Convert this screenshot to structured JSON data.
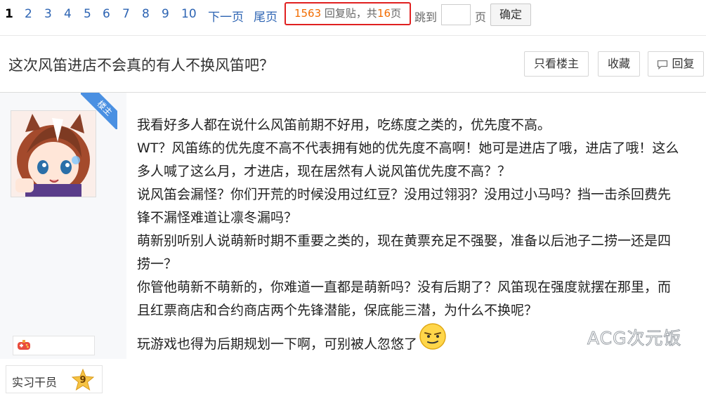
{
  "pager": {
    "pages": [
      "1",
      "2",
      "3",
      "4",
      "5",
      "6",
      "7",
      "8",
      "9",
      "10"
    ],
    "current": "1",
    "next_label": "下一页",
    "last_label": "尾页",
    "reply_count": "1563",
    "reply_text": "回复贴，共",
    "page_total": "16",
    "page_unit": "页",
    "jump_label": "跳到",
    "page_label": "页",
    "confirm_label": "确定"
  },
  "thread": {
    "title": "这次风笛进店不会真的有人不换风笛吧？",
    "btn_only_op": "只看楼主",
    "btn_favorite": "收藏",
    "btn_reply": "回复"
  },
  "author": {
    "owner_tag": "楼主",
    "level_title": "实习干员",
    "level": "9"
  },
  "post": {
    "lines": [
      "我看好多人都在说什么风笛前期不好用，吃练度之类的，优先度不高。",
      "WT？风笛练的优先度不高不代表拥有她的优先度不高啊！她可是进店了哦，进店了哦！这么",
      "多人喊了这么月，才进店，现在居然有人说风笛优先度不高？？",
      "说风笛会漏怪？你们开荒的时候没用过红豆？没用过翎羽？没用过小马吗？挡一击杀回费先",
      "锋不漏怪难道让凛冬漏吗？",
      "萌新别听别人说萌新时期不重要之类的，现在黄票充足不强娶，准备以后池子二捞一还是四",
      "捞一？",
      "你管他萌新不萌新的，你难道一直都是萌新吗？没有后期了？风笛现在强度就摆在那里，而",
      "且红票商店和合约商店两个先锋潜能，保底能三潜，为什么不换呢？"
    ],
    "last_line": "玩游戏也得为后期规划一下啊，可别被人忽悠了"
  },
  "watermark": "ACG次元饭",
  "colors": {
    "link": "#2d64b3",
    "highlight": "#f26c00",
    "highlight_border": "#e02020",
    "ribbon": "#4a90e2"
  }
}
